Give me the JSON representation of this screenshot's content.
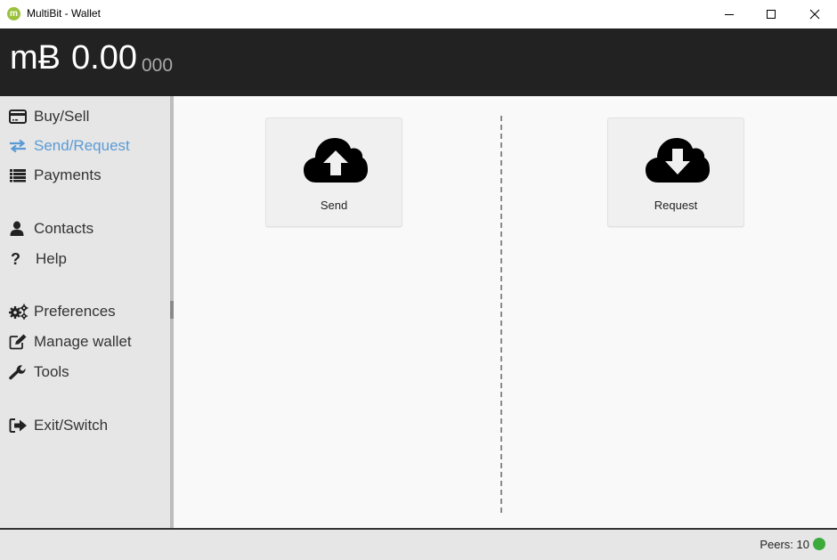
{
  "window": {
    "title": "MultiBit - Wallet",
    "app_icon_letter": "m",
    "controls": [
      "minimize",
      "maximize",
      "close"
    ]
  },
  "balance": {
    "symbol": "mɃ",
    "amount_main": "0.00",
    "amount_small": "000"
  },
  "sidebar": {
    "items": [
      {
        "label": "Buy/Sell",
        "icon": "credit-card-icon",
        "active": false
      },
      {
        "label": "Send/Request",
        "icon": "exchange-arrows-icon",
        "active": true
      },
      {
        "label": "Payments",
        "icon": "list-icon",
        "active": false
      },
      {
        "label": "Contacts",
        "icon": "user-icon",
        "active": false
      },
      {
        "label": "Help",
        "icon": "question-icon",
        "active": false
      },
      {
        "label": "Preferences",
        "icon": "gears-icon",
        "active": false
      },
      {
        "label": "Manage wallet",
        "icon": "edit-icon",
        "active": false
      },
      {
        "label": "Tools",
        "icon": "wrench-icon",
        "active": false
      },
      {
        "label": "Exit/Switch",
        "icon": "sign-out-icon",
        "active": false
      }
    ]
  },
  "main": {
    "send": {
      "label": "Send",
      "icon": "cloud-upload-icon"
    },
    "request": {
      "label": "Request",
      "icon": "cloud-download-icon"
    }
  },
  "statusbar": {
    "peers_text": "Peers: 10",
    "peers_status_color": "#3cab3c"
  },
  "colors": {
    "header_bg": "#222222",
    "active_nav": "#5b9bd5",
    "logo": "#9ac23c"
  }
}
